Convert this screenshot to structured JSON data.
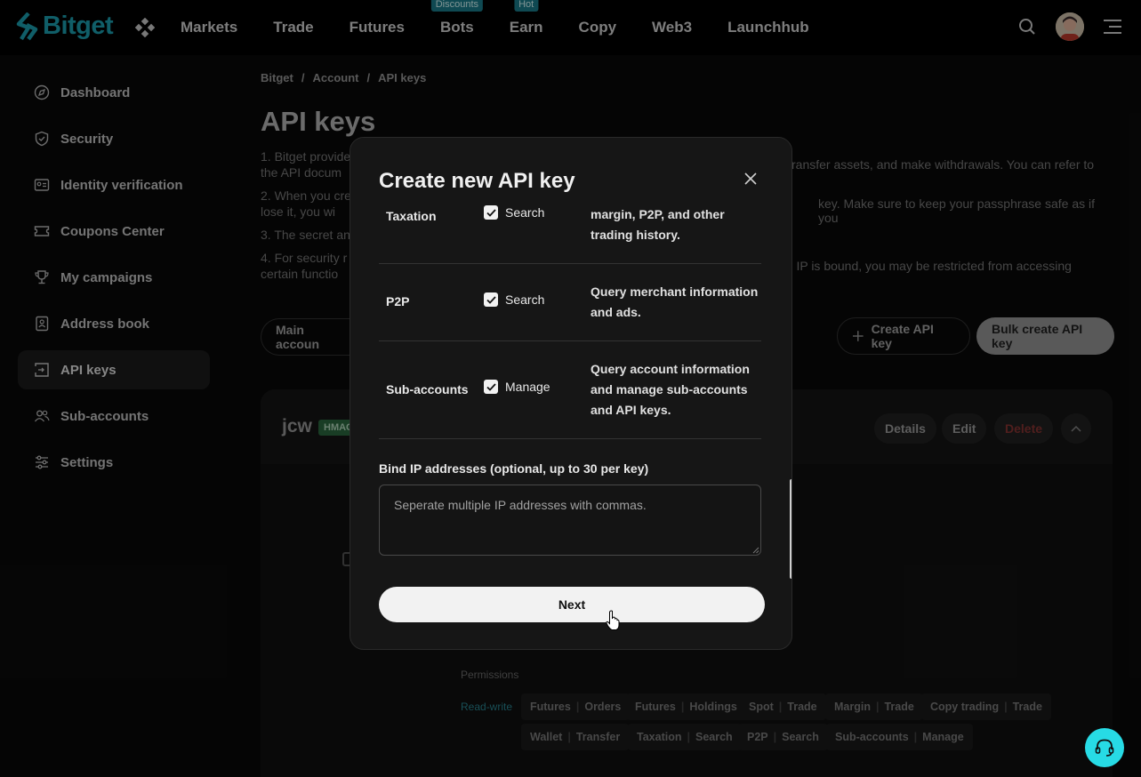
{
  "brand": {
    "name": "Bitget",
    "color": "#1da2b4"
  },
  "nav": {
    "items": [
      {
        "label": "Markets",
        "badge": ""
      },
      {
        "label": "Trade",
        "badge": ""
      },
      {
        "label": "Futures",
        "badge": ""
      },
      {
        "label": "Bots",
        "badge": "Discounts"
      },
      {
        "label": "Earn",
        "badge": "Hot"
      },
      {
        "label": "Copy",
        "badge": ""
      },
      {
        "label": "Web3",
        "badge": ""
      },
      {
        "label": "Launchhub",
        "badge": ""
      }
    ]
  },
  "sidebar": {
    "items": [
      {
        "label": "Dashboard",
        "icon": "compass-icon"
      },
      {
        "label": "Security",
        "icon": "shield-icon"
      },
      {
        "label": "Identity verification",
        "icon": "id-card-icon"
      },
      {
        "label": "Coupons Center",
        "icon": "ticket-icon"
      },
      {
        "label": "My campaigns",
        "icon": "trophy-icon"
      },
      {
        "label": "Address book",
        "icon": "contact-book-icon"
      },
      {
        "label": "API keys",
        "icon": "api-key-icon",
        "active": true
      },
      {
        "label": "Sub-accounts",
        "icon": "users-icon"
      },
      {
        "label": "Settings",
        "icon": "sliders-icon"
      }
    ]
  },
  "main": {
    "breadcrumb": [
      "Bitget",
      "/",
      "Account",
      "/",
      "API keys"
    ],
    "title": "API keys",
    "notes": [
      "1. Bitget provide",
      "the API docum",
      "2. When you cre",
      "lose it, you wi",
      "3. The secret an",
      "4. For security r",
      "certain functio"
    ],
    "notes_right": [
      "ransfer assets, and make withdrawals. You can refer to",
      "key. Make sure to keep your passphrase safe as if you",
      "no IP is bound, you may be restricted from accessing"
    ],
    "main_account_label": "Main accoun",
    "create_label": "Create API key",
    "bulk_create_label": "Bulk create API key",
    "card": {
      "name": "jcw",
      "badge": "HMAC",
      "details_label": "Details",
      "edit_label": "Edit",
      "delete_label": "Delete",
      "permissions_label": "Permissions",
      "read_write": "Read-write",
      "tags": [
        {
          "a": "Futures",
          "b": "Orders"
        },
        {
          "a": "Futures",
          "b": "Holdings"
        },
        {
          "a": "Spot",
          "b": "Trade"
        },
        {
          "a": "Margin",
          "b": "Trade"
        },
        {
          "a": "Copy trading",
          "b": "Trade"
        },
        {
          "a": "Wallet",
          "b": "Transfer"
        },
        {
          "a": "Taxation",
          "b": "Search"
        },
        {
          "a": "P2P",
          "b": "Search"
        },
        {
          "a": "Sub-accounts",
          "b": "Manage"
        }
      ]
    }
  },
  "modal": {
    "title": "Create new API key",
    "permissions": [
      {
        "name": "Taxation",
        "check_label": "Search",
        "desc": "margin, P2P, and other trading history."
      },
      {
        "name": "P2P",
        "check_label": "Search",
        "desc": "Query merchant information and ads."
      },
      {
        "name": "Sub-accounts",
        "check_label": "Manage",
        "desc": "Query account information and manage sub-accounts and API keys."
      }
    ],
    "ip_label": "Bind IP addresses (optional, up to 30 per key)",
    "ip_placeholder": "Seperate multiple IP addresses with commas.",
    "next_label": "Next"
  },
  "colors": {
    "accent": "#1da2b4",
    "delete": "#d9413e",
    "support": "#27dbe5"
  }
}
